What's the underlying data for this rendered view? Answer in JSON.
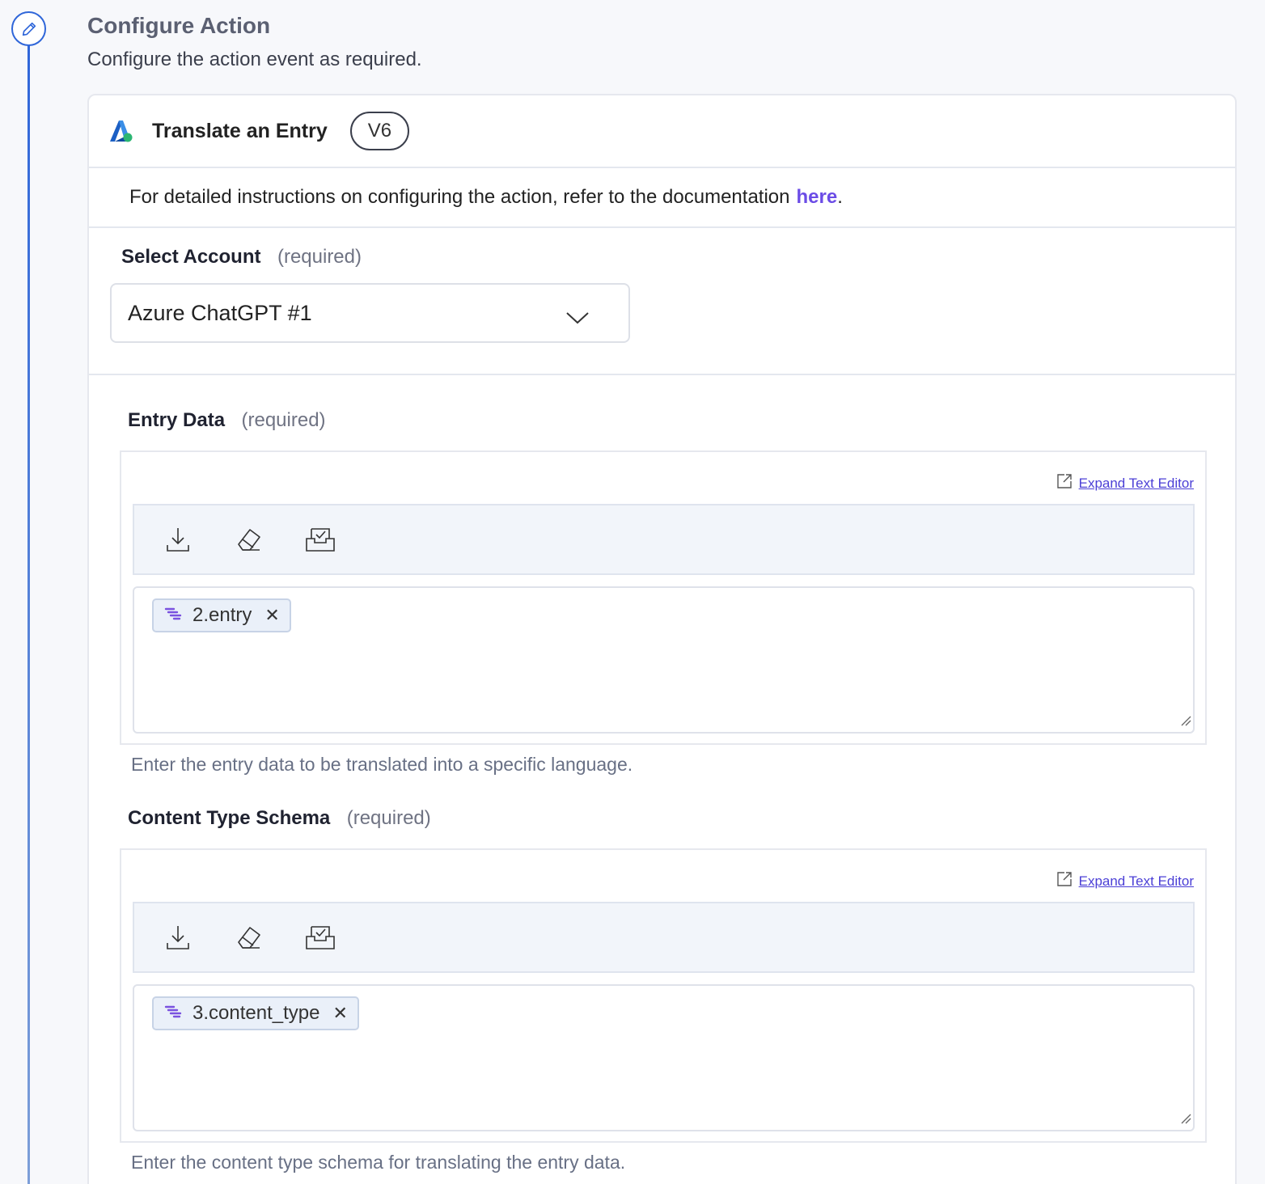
{
  "step": {
    "title": "Configure Action",
    "subtitle": "Configure the action event as required.",
    "icon": "pencil-icon"
  },
  "action": {
    "title": "Translate an Entry",
    "version": "V6",
    "logo": "azure-logo"
  },
  "docs": {
    "text": "For detailed instructions on configuring the action, refer to the documentation",
    "link_label": "here",
    "suffix": "."
  },
  "account": {
    "label": "Select Account",
    "required": "(required)",
    "value": "Azure ChatGPT #1"
  },
  "fields": [
    {
      "label": "Entry Data",
      "required": "(required)",
      "expand_label": "Expand Text Editor",
      "chip": "2.entry",
      "helper": "Enter the entry data to be translated into a specific language."
    },
    {
      "label": "Content Type Schema",
      "required": "(required)",
      "expand_label": "Expand Text Editor",
      "chip": "3.content_type",
      "helper": "Enter the content type schema for translating the entry data."
    }
  ],
  "colors": {
    "accent": "#2f66d9",
    "link": "#6b4ce6",
    "chip_bg": "#eaf0f9"
  }
}
